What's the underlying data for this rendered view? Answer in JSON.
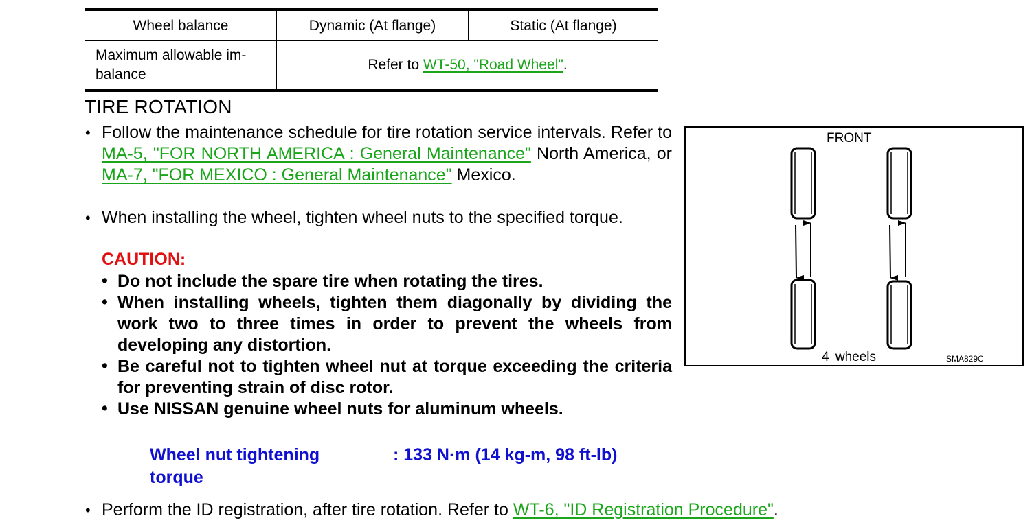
{
  "wheel_balance_table": {
    "headers": [
      "Wheel balance",
      "Dynamic (At flange)",
      "Static (At flange)"
    ],
    "rows": [
      {
        "label_line1": "Maximum allowable im-",
        "label_line2": "balance",
        "value_prefix": "Refer to ",
        "value_link": "WT-50, \"Road Wheel\"",
        "value_suffix": "."
      }
    ]
  },
  "section": {
    "title": "TIRE ROTATION",
    "bullets": [
      {
        "line1": "Follow the maintenance schedule for tire rotation service intervals.",
        "refer_to": "Refer to ",
        "link1": "MA-5, \"FOR NORTH AMERICA : General Maintenance\"",
        "mid_text": "North America, or ",
        "link2": "MA-7, \"FOR MEXICO : General Maintenance\"",
        "end_text": "Mexico."
      },
      {
        "text": "When installing the wheel, tighten wheel nuts to the specified torque."
      }
    ],
    "caution_label": "CAUTION:",
    "caution_items": [
      "Do not include the spare tire when rotating the tires.",
      "When installing wheels, tighten them diagonally by dividing the work two to three times in order to prevent the wheels from developing any distortion.",
      "Be careful not to tighten wheel nut at torque exceeding the criteria for preventing strain of disc rotor.",
      "Use NISSAN genuine wheel nuts for aluminum wheels."
    ],
    "torque_spec": {
      "label_line1": "Wheel nut tightening",
      "label_line2": "torque",
      "value": ": 133 N·m (14 kg-m, 98 ft-lb)"
    },
    "final_bullet": {
      "text": "Perform the ID registration, after tire rotation. Refer to ",
      "link": "WT-6, \"ID Registration Procedure\"",
      "suffix": "."
    }
  },
  "figure": {
    "top_label": "FRONT",
    "caption": "4 wheels",
    "code": "SMA829C"
  },
  "colors": {
    "link": "#1aa51a",
    "caution": "#e01010",
    "spec": "#1010d0"
  },
  "bullet_glyph": "•"
}
